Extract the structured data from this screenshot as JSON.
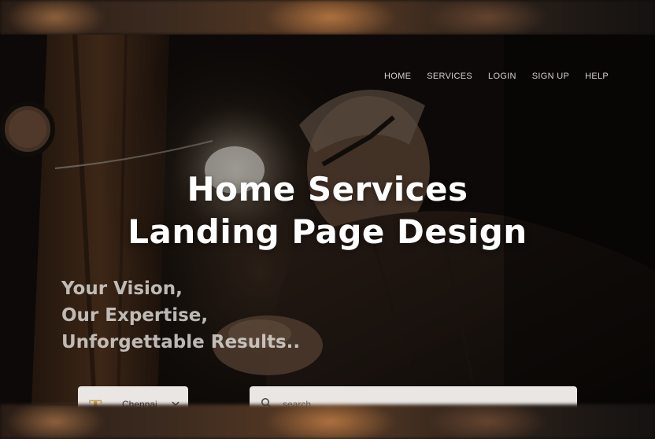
{
  "nav": {
    "items": [
      {
        "label": "HOME"
      },
      {
        "label": "SERVICES"
      },
      {
        "label": "LOGIN"
      },
      {
        "label": "SIGN UP"
      },
      {
        "label": "HELP"
      }
    ]
  },
  "headline": {
    "line1": "Home Services",
    "line2": "Landing Page Design"
  },
  "tagline": {
    "line1": "Your Vision,",
    "line2": "Our Expertise,",
    "line3": "Unforgettable Results.."
  },
  "location": {
    "value": "Chennai",
    "icon": "chevron-down-icon"
  },
  "search": {
    "placeholder": "search",
    "icon": "search-icon"
  },
  "colors": {
    "text_white": "#ffffff",
    "nav_text": "#d6d2cc",
    "input_bg": "#e9e6e3",
    "logo_gold": "#c9a24a"
  }
}
